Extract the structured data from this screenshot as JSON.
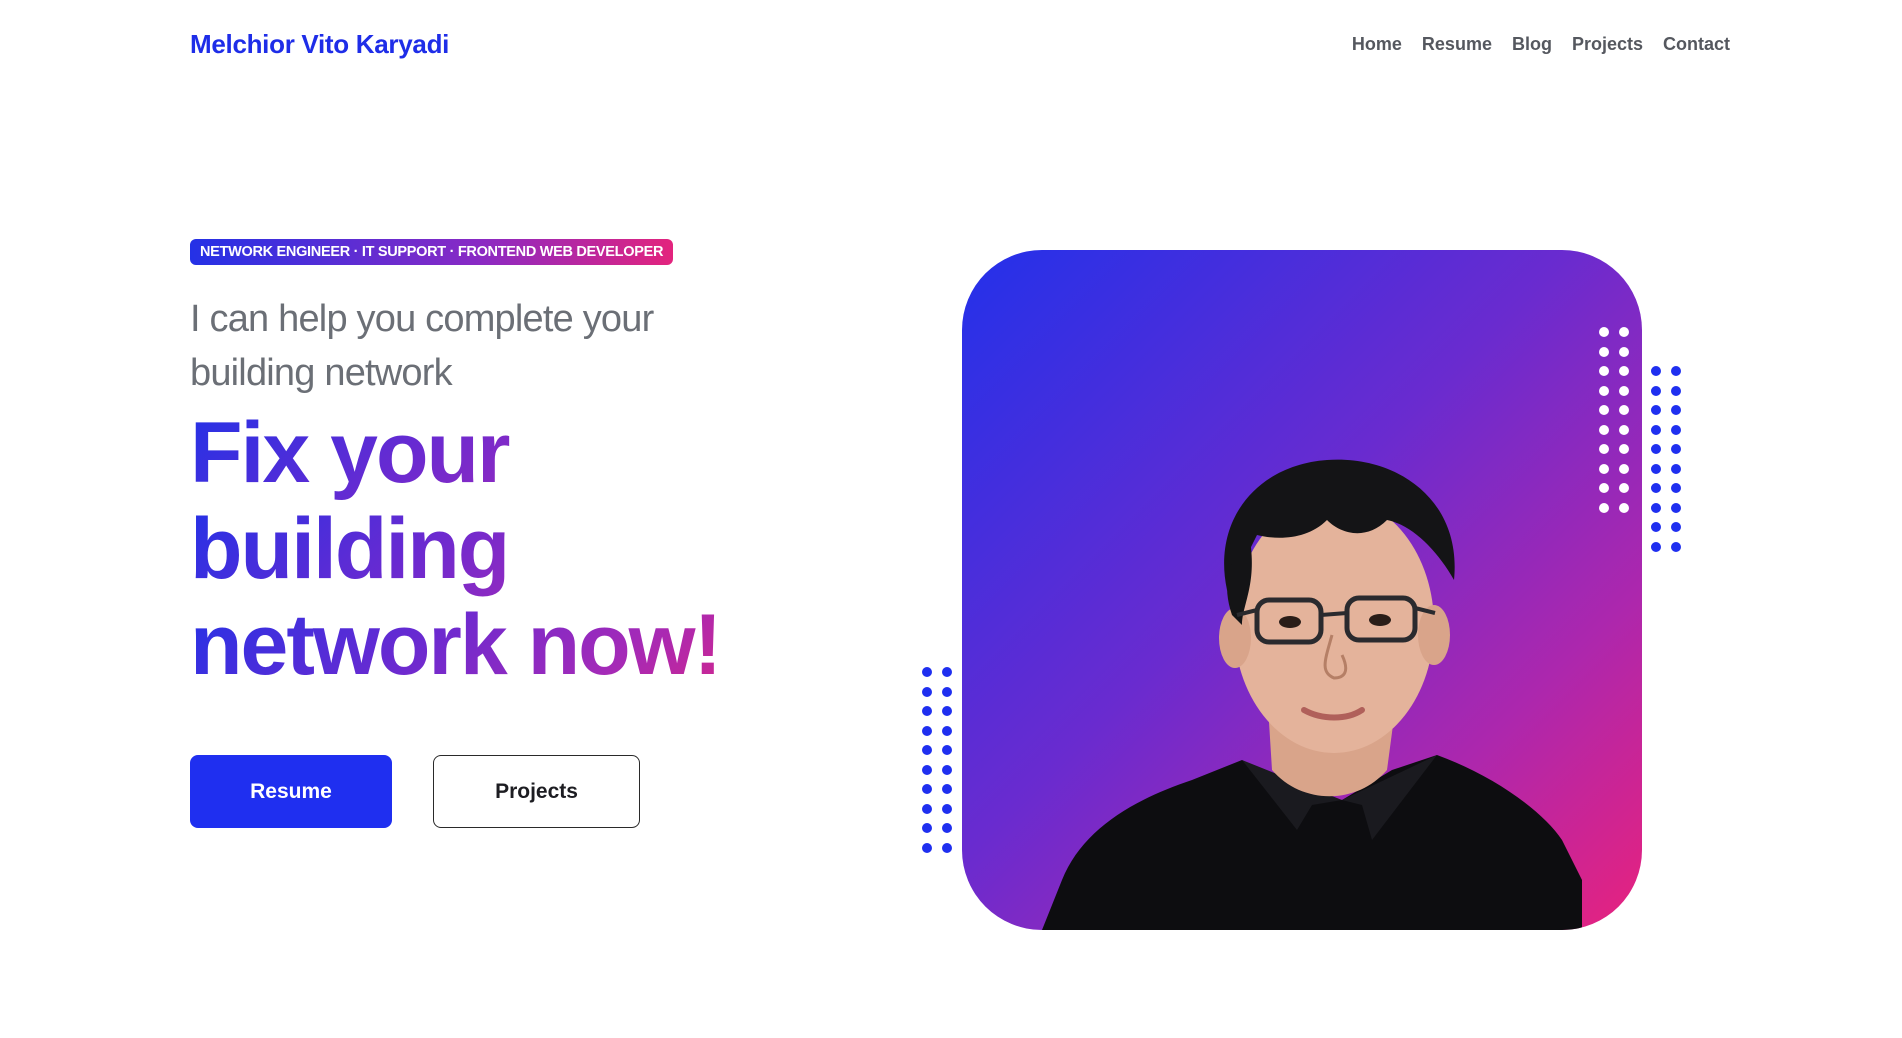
{
  "header": {
    "brand": "Melchior Vito Karyadi",
    "nav": [
      "Home",
      "Resume",
      "Blog",
      "Projects",
      "Contact"
    ]
  },
  "hero": {
    "badge": "NETWORK ENGINEER · IT SUPPORT · FRONTEND WEB DEVELOPER",
    "subheading": "I can help you complete your building network",
    "headline": [
      "Fix your",
      "building",
      "network now!"
    ],
    "primary_button": "Resume",
    "secondary_button": "Projects"
  },
  "colors": {
    "accent_blue": "#1f2ff0",
    "accent_purple": "#6a2bcf",
    "accent_pink": "#e8227d",
    "nav_text": "#55585f"
  },
  "icons": {
    "portrait": "profile-photo",
    "decorations": "dot-grid-decoration"
  }
}
